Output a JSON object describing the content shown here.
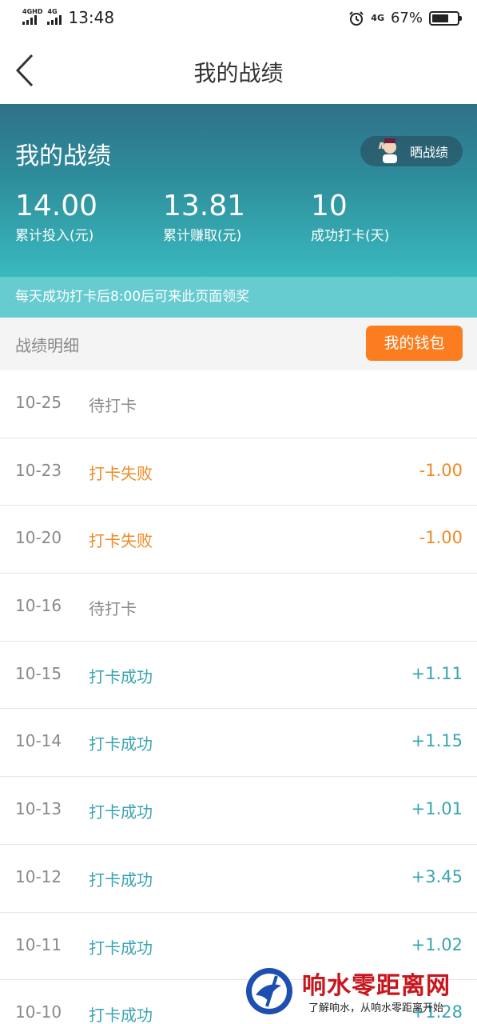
{
  "status_bar": {
    "network_left_1": "4GHD",
    "network_left_2": "4G",
    "time": "13:48",
    "network_right": "4G",
    "battery_text": "67%",
    "battery_level": 0.67
  },
  "nav": {
    "title": "我的战绩",
    "back_icon": "chevron-left-icon"
  },
  "hero": {
    "title": "我的战绩",
    "share_label": "晒战绩",
    "stats": [
      {
        "value": "14.00",
        "label": "累计投入(元)"
      },
      {
        "value": "13.81",
        "label": "累计赚取(元)"
      },
      {
        "value": "10",
        "label": "成功打卡(天)"
      }
    ]
  },
  "notice": "每天成功打卡后8:00后可来此页面领奖",
  "detail": {
    "title": "战绩明细",
    "wallet_label": "我的钱包"
  },
  "records": [
    {
      "date": "10-25",
      "status": "待打卡",
      "kind": "pending",
      "amount": ""
    },
    {
      "date": "10-23",
      "status": "打卡失败",
      "kind": "fail",
      "amount": "-1.00"
    },
    {
      "date": "10-20",
      "status": "打卡失败",
      "kind": "fail",
      "amount": "-1.00"
    },
    {
      "date": "10-16",
      "status": "待打卡",
      "kind": "pending",
      "amount": ""
    },
    {
      "date": "10-15",
      "status": "打卡成功",
      "kind": "success",
      "amount": "+1.11"
    },
    {
      "date": "10-14",
      "status": "打卡成功",
      "kind": "success",
      "amount": "+1.15"
    },
    {
      "date": "10-13",
      "status": "打卡成功",
      "kind": "success",
      "amount": "+1.01"
    },
    {
      "date": "10-12",
      "status": "打卡成功",
      "kind": "success",
      "amount": "+3.45"
    },
    {
      "date": "10-11",
      "status": "打卡成功",
      "kind": "success",
      "amount": "+1.02"
    },
    {
      "date": "10-10",
      "status": "打卡成功",
      "kind": "success",
      "amount": "+1.28"
    }
  ],
  "colors": {
    "pending": "#8a8a8a",
    "fail": "#f08a24",
    "success": "#3aa4b0",
    "wallet_button": "#fb7d20",
    "notice_bar": "#67cccf"
  },
  "watermark": {
    "name": "响水零距离网",
    "slogan": "了解响水，从响水零距离开始"
  }
}
